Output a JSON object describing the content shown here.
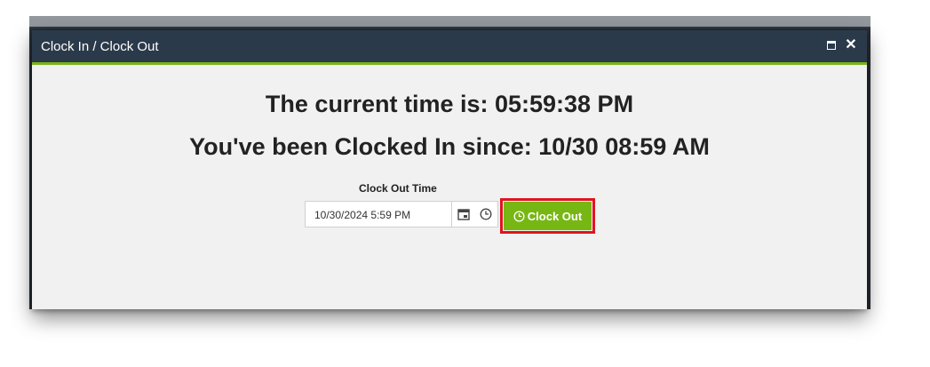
{
  "dialog": {
    "title": "Clock In / Clock Out"
  },
  "status": {
    "current_time": "The current time is: 05:59:38 PM",
    "clocked_in": "You've been Clocked In since: 10/30 08:59 AM"
  },
  "clock_out_form": {
    "label": "Clock Out Time",
    "value": "10/30/2024 5:59 PM",
    "button_label": "Clock Out"
  },
  "icons": {
    "maximize": "maximize-icon",
    "close": "close-icon",
    "calendar": "calendar-icon",
    "clock": "clock-icon"
  },
  "colors": {
    "titlebar": "#2b3a4b",
    "accent": "#7ab317",
    "button": "#77b714",
    "highlight": "#e0141e"
  }
}
